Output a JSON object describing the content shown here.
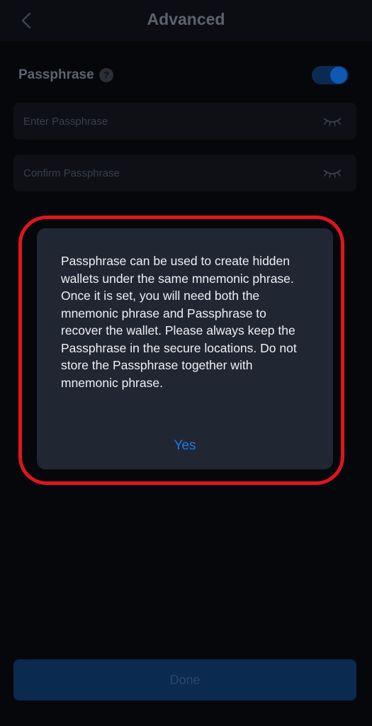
{
  "header": {
    "title": "Advanced",
    "back_icon": "chevron-left-icon"
  },
  "passphrase": {
    "label": "Passphrase",
    "help_icon": "help-circle-icon",
    "help_glyph": "?",
    "toggle_on": true,
    "enter_placeholder": "Enter Passphrase",
    "confirm_placeholder": "Confirm Passphrase",
    "visibility_icon": "eye-closed-icon"
  },
  "dialog": {
    "message": "Passphrase can be used to create hidden wallets under the same mnemonic phrase. Once it is set, you will need both the mnemonic phrase and Passphrase to recover the wallet. Please always keep the Passphrase in the secure locations. Do not store the Passphrase together with mnemonic phrase.",
    "confirm_label": "Yes",
    "highlight_color": "#e1141f"
  },
  "footer": {
    "done_label": "Done"
  },
  "colors": {
    "accent": "#1d79ea",
    "background": "#06070a",
    "dialog_bg": "#212633"
  }
}
